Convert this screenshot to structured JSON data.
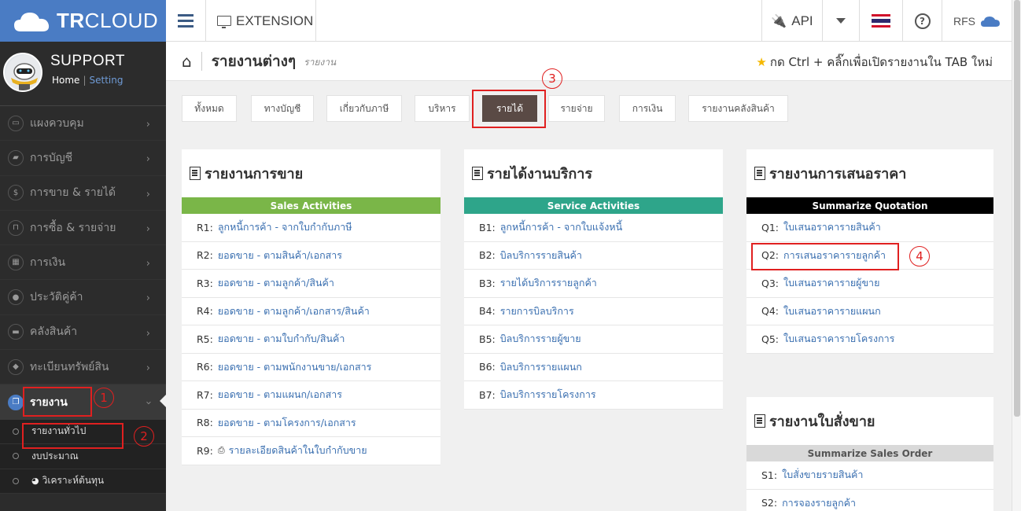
{
  "brand": {
    "logo_bold": "TR",
    "logo_rest": "CLOUD"
  },
  "profile": {
    "name": "SUPPORT",
    "home": "Home",
    "setting": "Setting"
  },
  "sidebar": {
    "items": [
      {
        "label": "แผงควบคุม",
        "icon": "monitor-icon"
      },
      {
        "label": "การบัญชี",
        "icon": "book-icon"
      },
      {
        "label": "การขาย & รายได้",
        "icon": "dollar-icon"
      },
      {
        "label": "การซื้อ & รายจ่าย",
        "icon": "cart-icon"
      },
      {
        "label": "การเงิน",
        "icon": "calendar-icon"
      },
      {
        "label": "ประวัติคู่ค้า",
        "icon": "users-icon"
      },
      {
        "label": "คลังสินค้า",
        "icon": "truck-icon"
      },
      {
        "label": "ทะเบียนทรัพย์สิน",
        "icon": "diamond-icon"
      }
    ],
    "active": {
      "label": "รายงาน",
      "icon": "copy-icon"
    },
    "submenu": [
      {
        "label": "รายงานทั่วไป"
      },
      {
        "label": "งบประมาณ"
      },
      {
        "label": "วิเคราะห์ต้นทุน"
      }
    ]
  },
  "topbar": {
    "extension": "EXTENSION",
    "api": "API",
    "rfs": "RFS"
  },
  "page": {
    "title": "รายงานต่างๆ",
    "subtitle": "รายงาน",
    "hint": "กด Ctrl + คลิ๊กเพื่อเปิดรายงานใน TAB ใหม่"
  },
  "tabs": [
    {
      "label": "ทั้งหมด"
    },
    {
      "label": "ทางบัญชี"
    },
    {
      "label": "เกี่ยวกับภาษี"
    },
    {
      "label": "บริหาร"
    },
    {
      "label": "รายได้"
    },
    {
      "label": "รายจ่าย"
    },
    {
      "label": "การเงิน"
    },
    {
      "label": "รายงานคลังสินค้า"
    }
  ],
  "panels": {
    "sales": {
      "title": "รายงานการขาย",
      "band": "Sales Activities",
      "band_color": "#7ab648",
      "rows": [
        {
          "code": "R1:",
          "label": "ลูกหนี้การค้า - จากใบกำกับภาษี"
        },
        {
          "code": "R2:",
          "label": "ยอดขาย - ตามสินค้า/เอกสาร"
        },
        {
          "code": "R3:",
          "label": "ยอดขาย - ตามลูกค้า/สินค้า"
        },
        {
          "code": "R4:",
          "label": "ยอดขาย - ตามลูกค้า/เอกสาร/สินค้า"
        },
        {
          "code": "R5:",
          "label": "ยอดขาย - ตามใบกำกับ/สินค้า"
        },
        {
          "code": "R6:",
          "label": "ยอดขาย - ตามพนักงานขาย/เอกสาร"
        },
        {
          "code": "R7:",
          "label": "ยอดขาย - ตามแผนก/เอกสาร"
        },
        {
          "code": "R8:",
          "label": "ยอดขาย - ตามโครงการ/เอกสาร"
        },
        {
          "code": "R9:",
          "label": "รายละเอียดสินค้าในใบกำกับขาย"
        }
      ]
    },
    "service": {
      "title": "รายได้งานบริการ",
      "band": "Service Activities",
      "band_color": "#2ea58a",
      "rows": [
        {
          "code": "B1:",
          "label": "ลูกหนี้การค้า - จากใบแจ้งหนี้"
        },
        {
          "code": "B2:",
          "label": "บิลบริการรายสินค้า"
        },
        {
          "code": "B3:",
          "label": "รายได้บริการรายลูกค้า"
        },
        {
          "code": "B4:",
          "label": "รายการบิลบริการ"
        },
        {
          "code": "B5:",
          "label": "บิลบริการรายผู้ขาย"
        },
        {
          "code": "B6:",
          "label": "บิลบริการรายแผนก"
        },
        {
          "code": "B7:",
          "label": "บิลบริการรายโครงการ"
        }
      ]
    },
    "quotation": {
      "title": "รายงานการเสนอราคา",
      "band": "Summarize Quotation",
      "band_color": "#000000",
      "rows": [
        {
          "code": "Q1:",
          "label": "ใบเสนอราคารายสินค้า"
        },
        {
          "code": "Q2:",
          "label": "การเสนอราคารายลูกค้า"
        },
        {
          "code": "Q3:",
          "label": "ใบเสนอราคารายผู้ขาย"
        },
        {
          "code": "Q4:",
          "label": "ใบเสนอราคารายแผนก"
        },
        {
          "code": "Q5:",
          "label": "ใบเสนอราคารายโครงการ"
        }
      ]
    },
    "salesorder": {
      "title": "รายงานใบสั่งขาย",
      "band": "Summarize Sales Order",
      "band_color": "#d9d9d9",
      "rows": [
        {
          "code": "S1:",
          "label": "ใบสั่งขายรายสินค้า"
        },
        {
          "code": "S2:",
          "label": "การจองรายลูกค้า"
        }
      ]
    }
  },
  "annotations": [
    "1",
    "2",
    "3",
    "4"
  ],
  "colors": {
    "accent": "#4a7cc4",
    "highlight": "#e02020",
    "link": "#3a6fb0"
  }
}
